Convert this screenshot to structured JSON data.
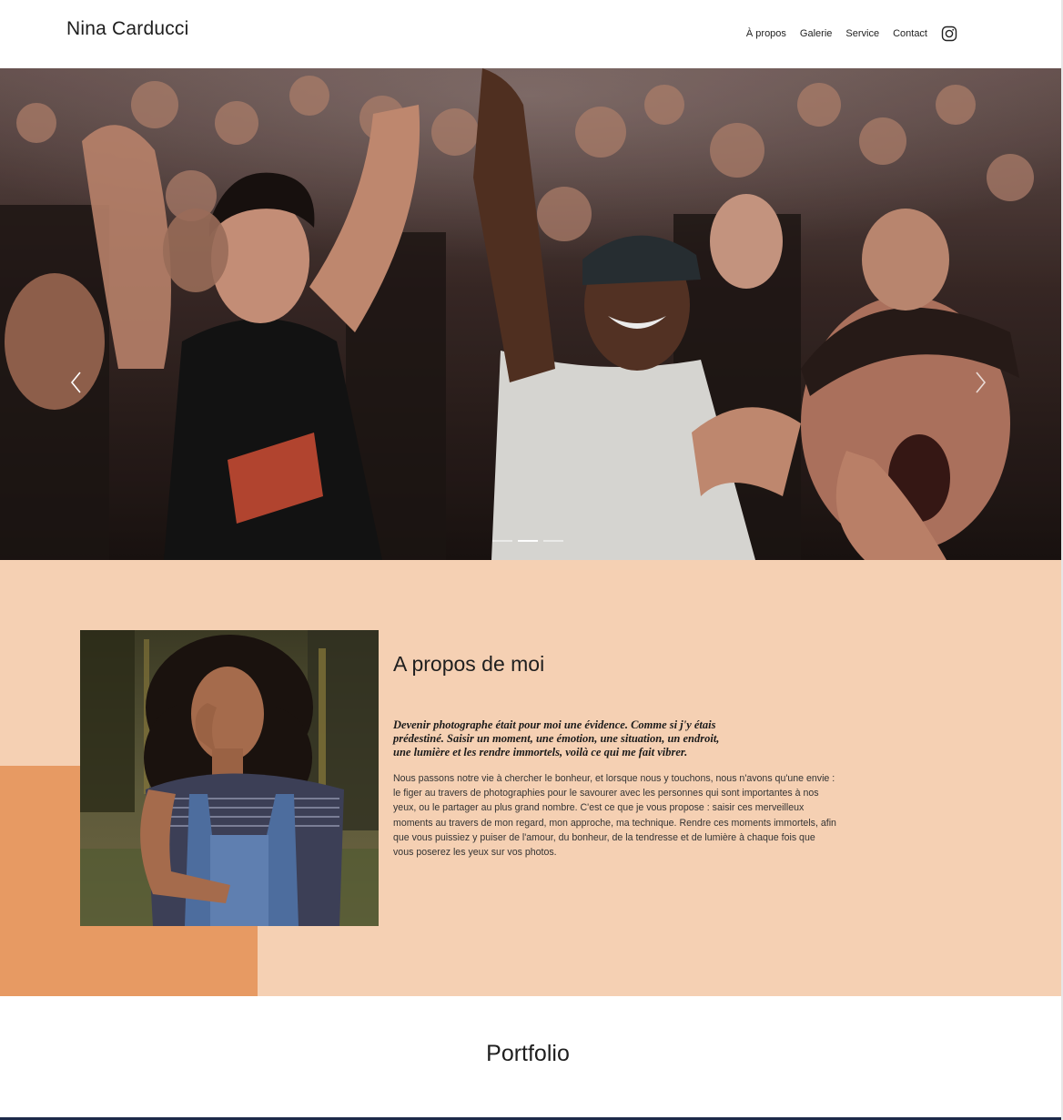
{
  "header": {
    "brand": "Nina Carducci",
    "nav": [
      "À propos",
      "Galerie",
      "Service",
      "Contact"
    ],
    "instagram_icon": "instagram-icon"
  },
  "carousel": {
    "slide_count": 3,
    "active_index": 1,
    "prev_icon": "chevron-left-icon",
    "next_icon": "chevron-right-icon"
  },
  "about": {
    "title": "A propos de moi",
    "quote_lines": [
      "Devenir photographe était pour moi une évidence. Comme si j'y étais",
      "prédestiné. Saisir un moment, une émotion, une situation, un endroit,",
      "une lumière et les rendre immortels, voilà ce qui me fait vibrer."
    ],
    "text_lines": [
      "Nous passons notre vie à chercher le bonheur, et lorsque nous y touchons, nous n'avons qu'une envie :",
      "le figer au travers de photographies pour le savourer avec les personnes qui sont importantes à nos",
      "yeux, ou le partager au plus grand nombre. C'est ce que je vous propose : saisir ces merveilleux",
      "moments au travers de mon regard, mon approche, ma technique. Rendre ces moments immortels, afin",
      "que vous puissiez y puiser de l'amour, du bonheur, de la tendresse et de lumière à chaque fois que",
      "vous poserez les yeux sur vos photos."
    ]
  },
  "portfolio": {
    "title": "Portfolio"
  },
  "colors": {
    "about_bg": "#f5d0b3",
    "accent": "#e79a63",
    "text": "#1f1f1f"
  }
}
